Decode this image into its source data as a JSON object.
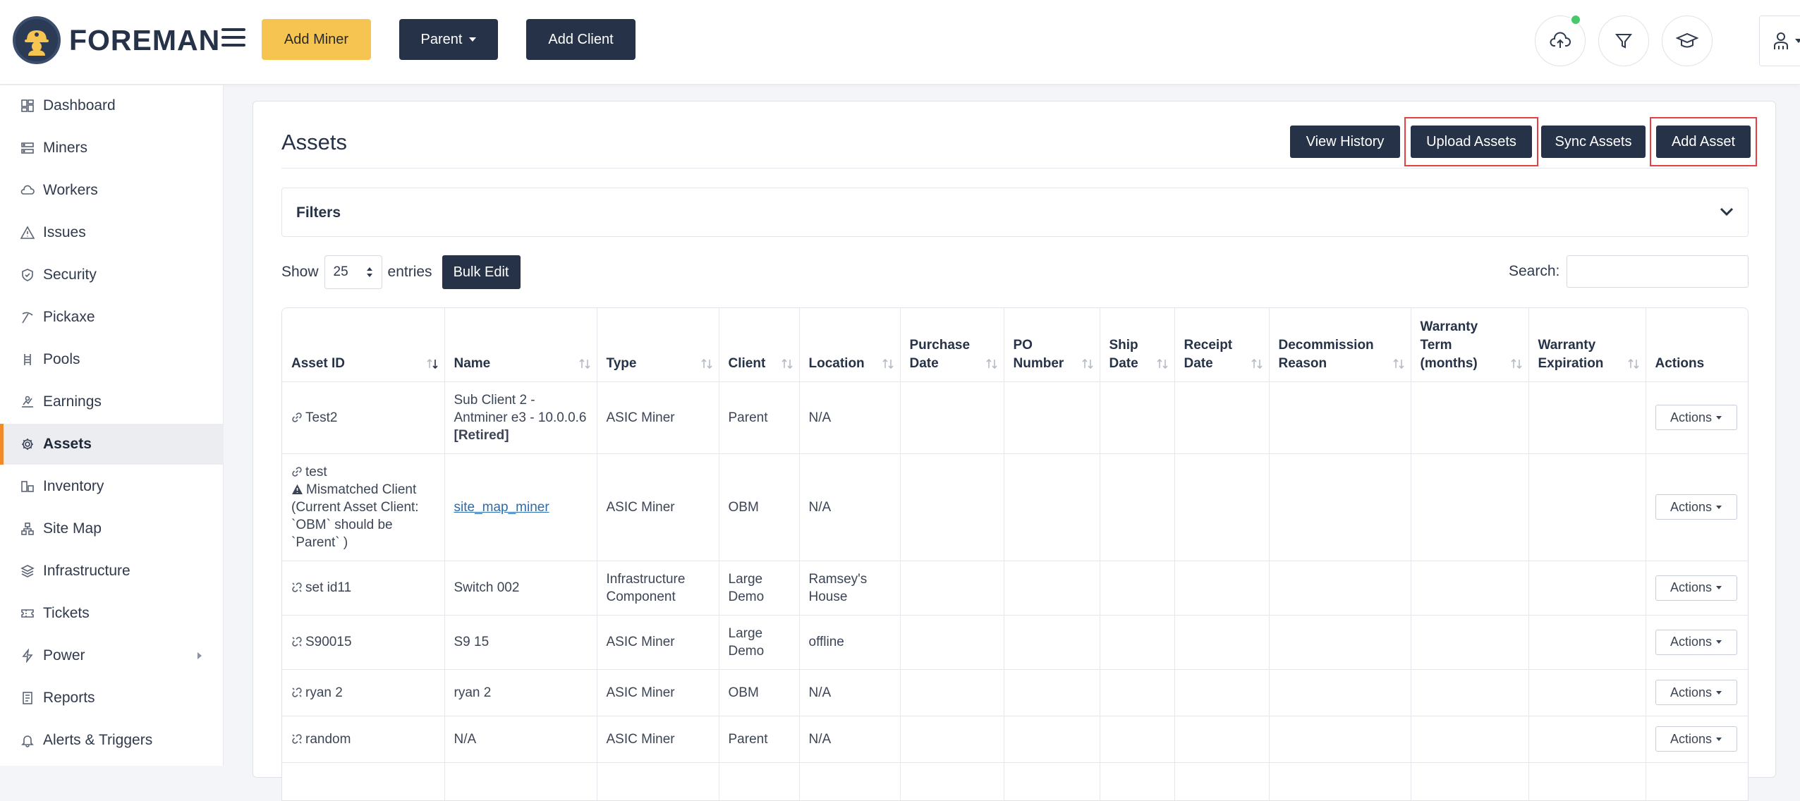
{
  "brand": {
    "name": "FOREMAN"
  },
  "topbar": {
    "add_miner": "Add Miner",
    "parent": "Parent",
    "add_client": "Add Client"
  },
  "sidebar": {
    "items": [
      {
        "label": "Dashboard",
        "icon": "dashboard-icon"
      },
      {
        "label": "Miners",
        "icon": "server-icon"
      },
      {
        "label": "Workers",
        "icon": "cloud-icon"
      },
      {
        "label": "Issues",
        "icon": "warning-icon"
      },
      {
        "label": "Security",
        "icon": "shield-icon"
      },
      {
        "label": "Pickaxe",
        "icon": "pickaxe-icon"
      },
      {
        "label": "Pools",
        "icon": "pools-icon"
      },
      {
        "label": "Earnings",
        "icon": "earnings-icon"
      },
      {
        "label": "Assets",
        "icon": "gear-icon",
        "active": true
      },
      {
        "label": "Inventory",
        "icon": "inventory-icon"
      },
      {
        "label": "Site Map",
        "icon": "sitemap-icon"
      },
      {
        "label": "Infrastructure",
        "icon": "layers-icon"
      },
      {
        "label": "Tickets",
        "icon": "ticket-icon"
      },
      {
        "label": "Power",
        "icon": "bolt-icon"
      },
      {
        "label": "Reports",
        "icon": "reports-icon"
      },
      {
        "label": "Alerts & Triggers",
        "icon": "bell-icon"
      }
    ]
  },
  "page": {
    "title": "Assets",
    "view_history": "View History",
    "upload_assets": "Upload Assets",
    "sync_assets": "Sync Assets",
    "add_asset": "Add Asset",
    "filters": "Filters",
    "show": "Show",
    "entries_value": "25",
    "entries": "entries",
    "bulk_edit": "Bulk Edit",
    "search_label": "Search:",
    "search_value": ""
  },
  "table": {
    "columns": [
      "Asset ID",
      "Name",
      "Type",
      "Client",
      "Location",
      "Purchase Date",
      "PO Number",
      "Ship Date",
      "Receipt Date",
      "Decommission Reason",
      "Warranty Term (months)",
      "Warranty Expiration",
      "Actions"
    ],
    "action_label": "Actions",
    "rows": [
      {
        "id": "Test2",
        "id_icon": "link-icon",
        "name": "Sub Client 2 - Antminer e3 - 10.0.0.6",
        "name_suffix": "[Retired]",
        "type": "ASIC Miner",
        "client": "Parent",
        "location": "N/A"
      },
      {
        "id": "test",
        "id_icon": "link-icon",
        "warning": "Mismatched Client (Current Asset Client: `OBM` should be `Parent` )",
        "name": "site_map_miner",
        "name_link": true,
        "type": "ASIC Miner",
        "client": "OBM",
        "location": "N/A"
      },
      {
        "id": "set id11",
        "id_icon": "unlink-icon",
        "name": "Switch 002",
        "type": "Infrastructure Component",
        "client": "Large Demo",
        "location": "Ramsey's House"
      },
      {
        "id": "S90015",
        "id_icon": "unlink-icon",
        "name": "S9 15",
        "type": "ASIC Miner",
        "client": "Large Demo",
        "location": "offline"
      },
      {
        "id": "ryan 2",
        "id_icon": "unlink-icon",
        "name": "ryan 2",
        "type": "ASIC Miner",
        "client": "OBM",
        "location": "N/A"
      },
      {
        "id": "random",
        "id_icon": "unlink-icon",
        "name": "N/A",
        "type": "ASIC Miner",
        "client": "Parent",
        "location": "N/A"
      }
    ]
  }
}
